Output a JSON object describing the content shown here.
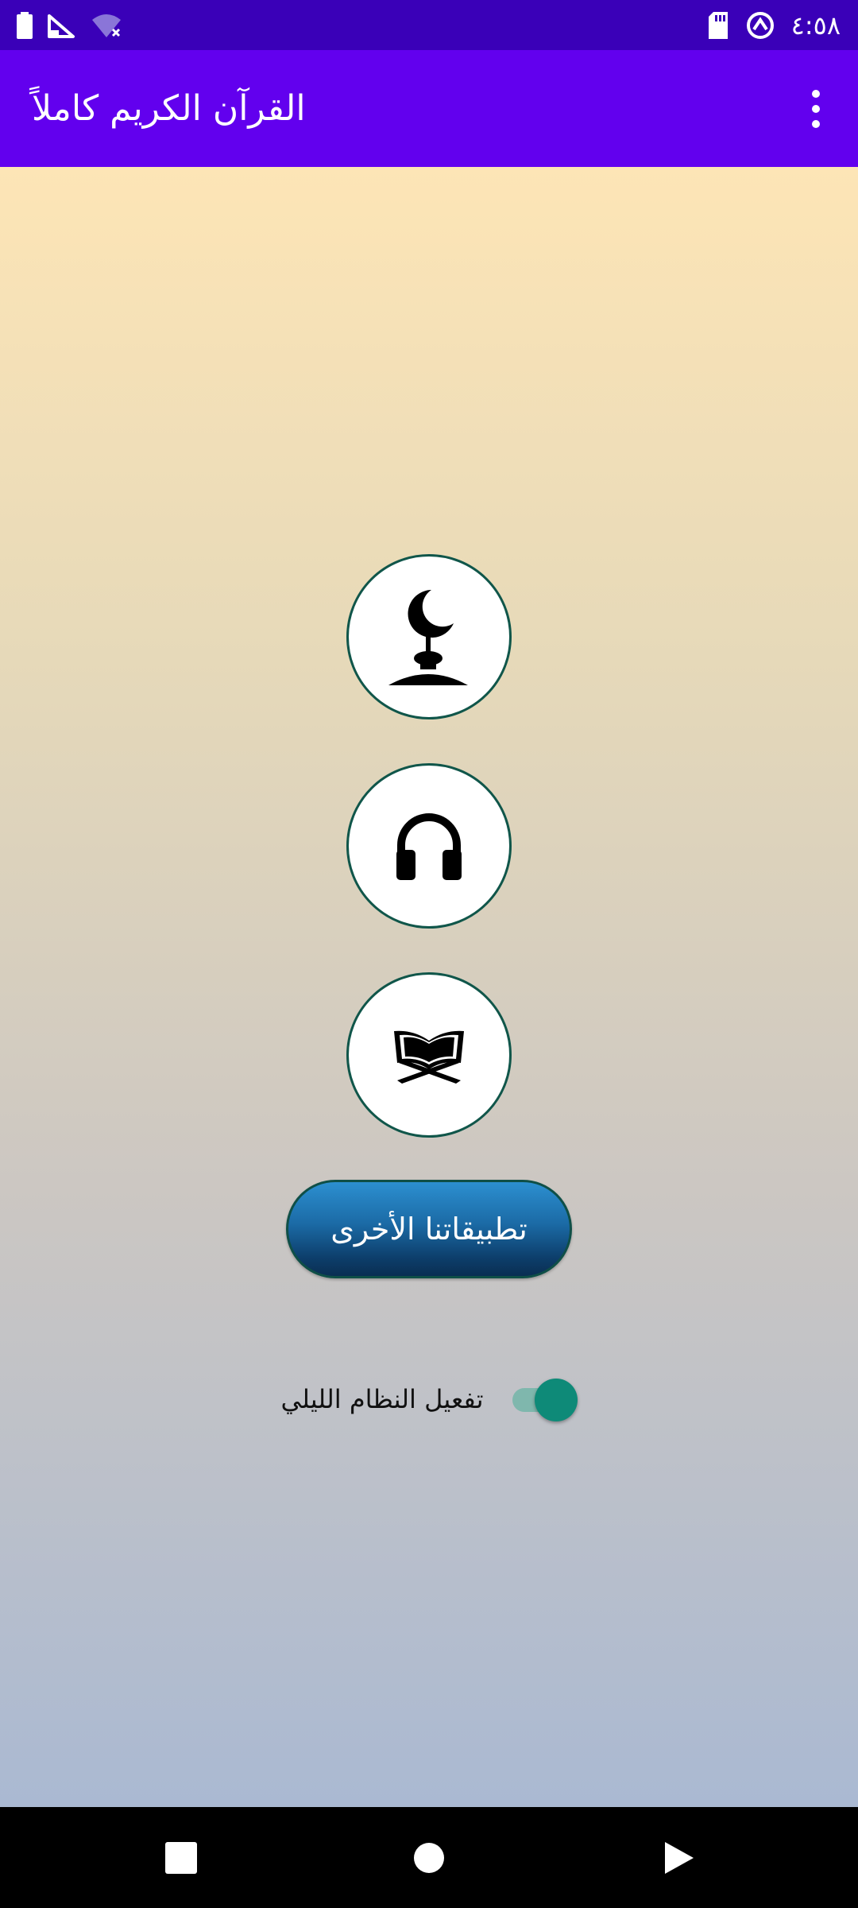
{
  "status_bar": {
    "time": "٤:٥٨",
    "icons": [
      "battery-icon",
      "signal-icon",
      "wifi-off-icon",
      "sd-card-icon",
      "data-saver-icon"
    ]
  },
  "app_bar": {
    "title": "القرآن الكريم كاملاً",
    "overflow_icon": "more-vert-icon",
    "color": "#6200ee"
  },
  "main": {
    "buttons": [
      {
        "icon": "mosque-crescent-icon"
      },
      {
        "icon": "headphones-icon"
      },
      {
        "icon": "quran-book-icon"
      }
    ],
    "other_apps_label": "تطبيقاتنا الأخرى",
    "night_mode": {
      "label": "تفعيل النظام الليلي",
      "enabled": true,
      "accent": "#0e8a78"
    }
  },
  "nav_bar": {
    "icons": [
      "recents-icon",
      "home-icon",
      "back-icon"
    ]
  }
}
